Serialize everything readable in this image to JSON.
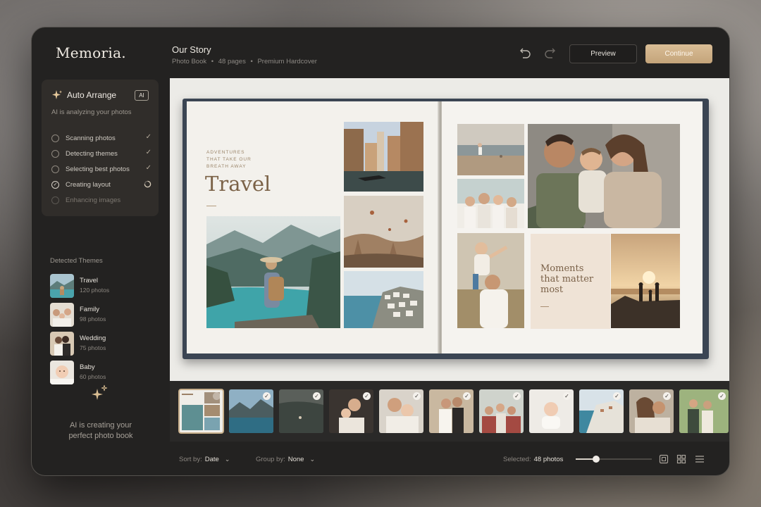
{
  "app": {
    "name": "Memoria."
  },
  "project": {
    "title": "Our Story",
    "type": "Photo Book",
    "pages": "48 pages",
    "finish": "Premium Hardcover",
    "separator": "•"
  },
  "toolbar": {
    "undo_icon": "undo-icon",
    "redo_icon": "redo-icon",
    "preview_label": "Preview",
    "continue_label": "Continue"
  },
  "auto_arrange": {
    "title": "Auto Arrange",
    "badge": "AI",
    "status": "AI is analyzing your photos",
    "steps": [
      {
        "label": "Scanning photos",
        "state": "done"
      },
      {
        "label": "Detecting themes",
        "state": "done"
      },
      {
        "label": "Selecting best photos",
        "state": "done"
      },
      {
        "label": "Creating layout",
        "state": "in-progress"
      },
      {
        "label": "Enhancing images",
        "state": "pending"
      }
    ]
  },
  "themes": {
    "label": "Detected Themes",
    "items": [
      {
        "name": "Travel",
        "count": "120 photos"
      },
      {
        "name": "Family",
        "count": "98 photos"
      },
      {
        "name": "Wedding",
        "count": "75 photos"
      },
      {
        "name": "Baby",
        "count": "60 photos"
      }
    ]
  },
  "ai_footer": {
    "line1": "AI is creating your",
    "line2": "perfect photo book"
  },
  "spread": {
    "tagline": [
      "ADVENTURES",
      "THAT TAKE OUR",
      "BREATH AWAY"
    ],
    "title": "Travel",
    "quote": [
      "Moments",
      "that matter",
      "most"
    ]
  },
  "filmstrip": {
    "count": 11,
    "selected_index": 0,
    "checked": [
      false,
      true,
      true,
      true,
      true,
      true,
      true,
      true,
      true,
      true,
      true
    ]
  },
  "footer": {
    "sort_label": "Sort by:",
    "sort_value": "Date",
    "group_label": "Group by:",
    "group_value": "None",
    "selected_label": "Selected:",
    "selected_value": "48 photos",
    "zoom_level": 0.27
  },
  "colors": {
    "accent": "#c9ab80",
    "window": "#232221",
    "canvas": "#ecebe7"
  }
}
